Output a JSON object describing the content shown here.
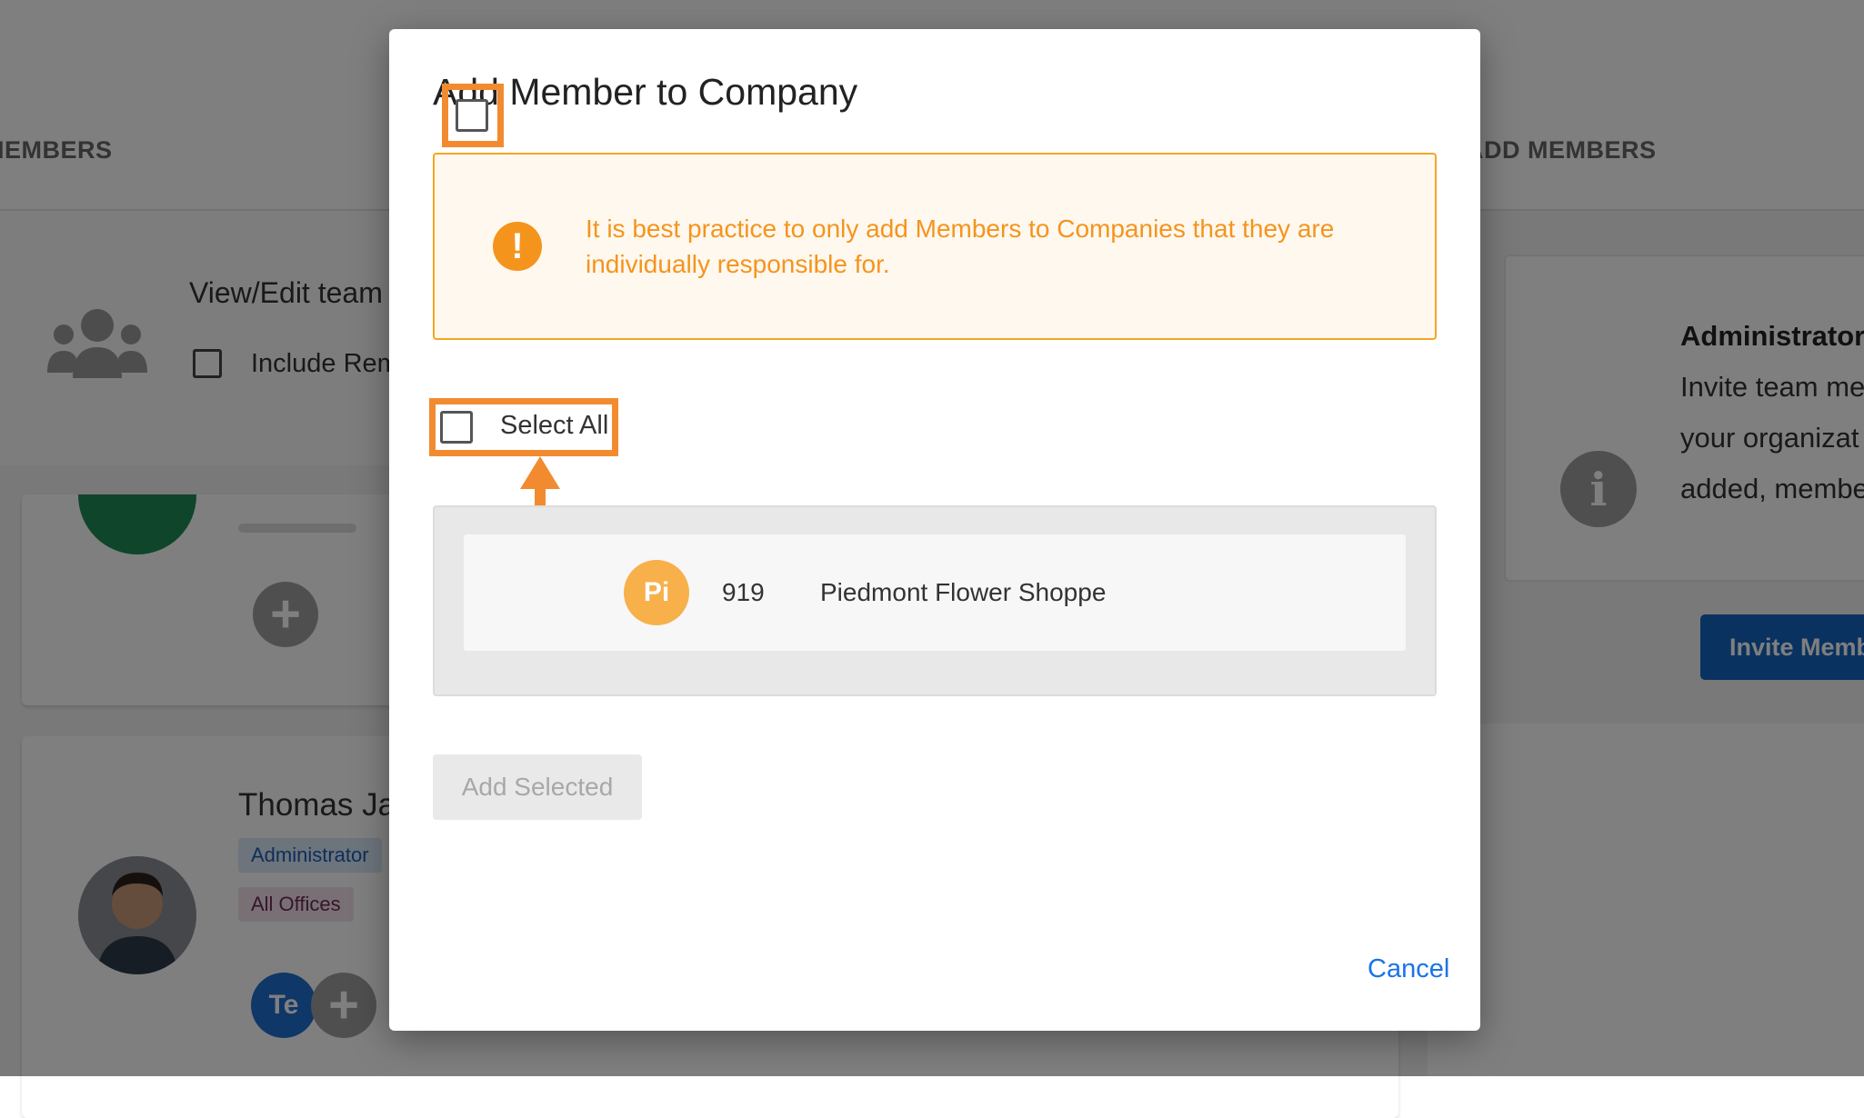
{
  "background": {
    "tabs": {
      "left_label": "MEMBERS",
      "right_label": "ADD MEMBERS"
    },
    "team_panel": {
      "title": "View/Edit team",
      "include_label": "Include Rem"
    },
    "member_card": {
      "name": "Thomas Ja",
      "role_chip": "Administrator",
      "offices_chip": "All Offices",
      "team_badge": "Te"
    },
    "admin_card": {
      "title": "Administrator",
      "lines": [
        "Invite team me",
        "your organizat",
        "added, membe"
      ],
      "invite_button": "Invite Memb"
    }
  },
  "modal": {
    "title": "Add Member to Company",
    "alert": {
      "icon": "exclamation-icon",
      "text": "It is best practice to only add Members to Companies that they are individually responsible for."
    },
    "select_all_label": "Select All",
    "companies": [
      {
        "initials": "Pi",
        "id": "919",
        "name": "Piedmont Flower Shoppe"
      }
    ],
    "add_selected_label": "Add Selected",
    "cancel_label": "Cancel"
  },
  "colors": {
    "accent_orange": "#f28b30",
    "alert_text": "#f5941d",
    "link_blue": "#1a73e8",
    "primary_button": "#1565c0"
  }
}
